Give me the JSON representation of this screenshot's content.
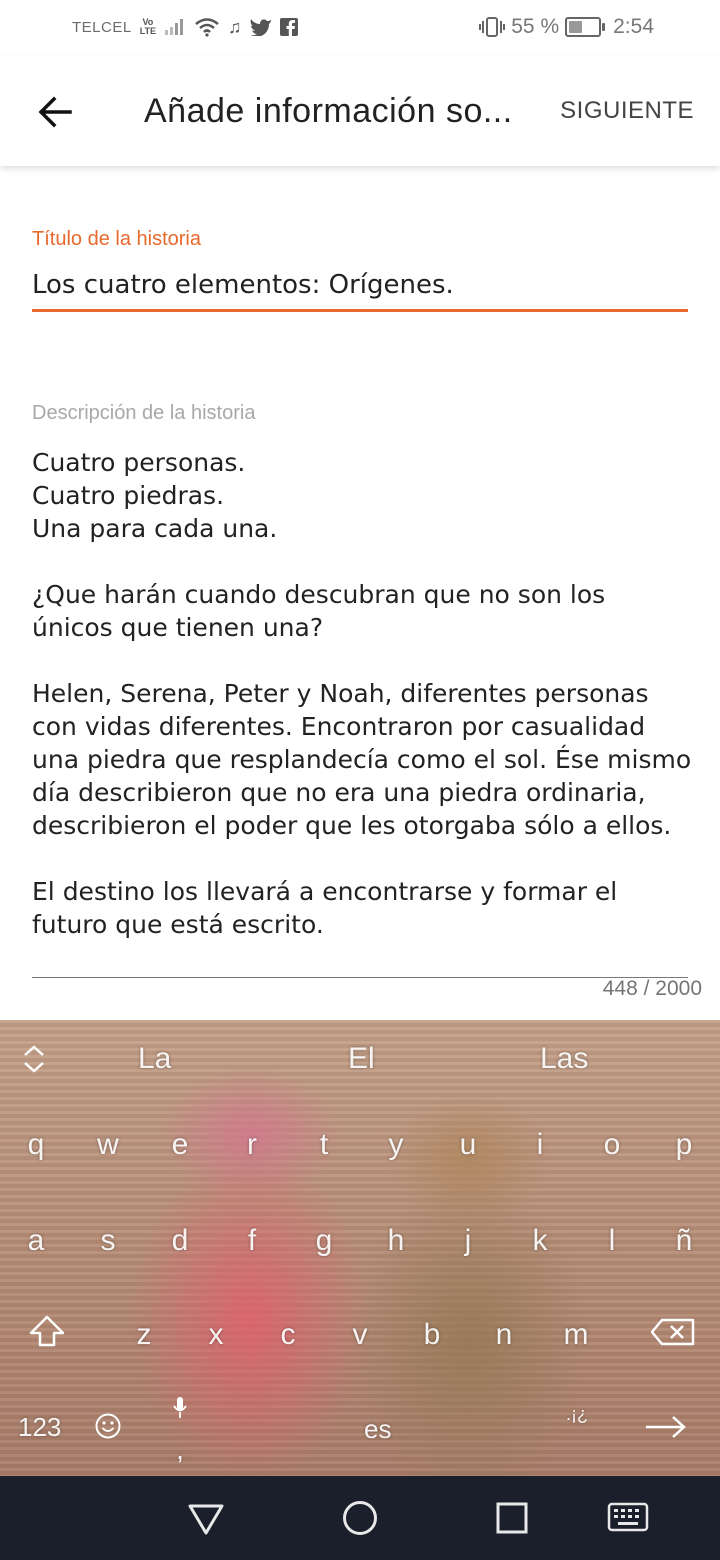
{
  "status_bar": {
    "carrier": "TELCEL",
    "network_badge_top": "Vo",
    "network_badge_bottom": "LTE",
    "battery_percent": "55 %",
    "battery_level": 0.55,
    "time": "2:54",
    "icons": [
      "signal-icon",
      "wifi-icon",
      "music-icon",
      "twitter-icon",
      "facebook-icon",
      "vibrate-icon",
      "battery-icon"
    ]
  },
  "app_bar": {
    "title": "Añade información so...",
    "next_label": "SIGUIENTE"
  },
  "form": {
    "title_label": "Título de la historia",
    "title_value": "Los cuatro elementos: Orígenes.",
    "description_label": "Descripción de la historia",
    "description_value": "Cuatro personas.\nCuatro piedras.\nUna para cada una.\n\n¿Que harán cuando descubran que no son los únicos que tienen una?\n\nHelen, Serena, Peter y Noah, diferentes personas con vidas diferentes. Encontraron por casualidad una piedra que resplandecía como el sol. Ése mismo día describieron que no era una piedra ordinaria, describieron el poder que les otorgaba sólo a ellos.\n\nEl destino los llevará a encontrarse y formar el futuro que está escrito.",
    "char_count": "448 / 2000",
    "accent_color": "#e8692c"
  },
  "keyboard": {
    "suggestions": [
      "La",
      "El",
      "Las"
    ],
    "row1": [
      "q",
      "w",
      "e",
      "r",
      "t",
      "y",
      "u",
      "i",
      "o",
      "p"
    ],
    "row2": [
      "a",
      "s",
      "d",
      "f",
      "g",
      "h",
      "j",
      "k",
      "l",
      "ñ"
    ],
    "row3": [
      "z",
      "x",
      "c",
      "v",
      "b",
      "n",
      "m"
    ],
    "numbers_label": "123",
    "comma_label": ",",
    "space_label": "es",
    "punct_label": ".¡¿"
  }
}
